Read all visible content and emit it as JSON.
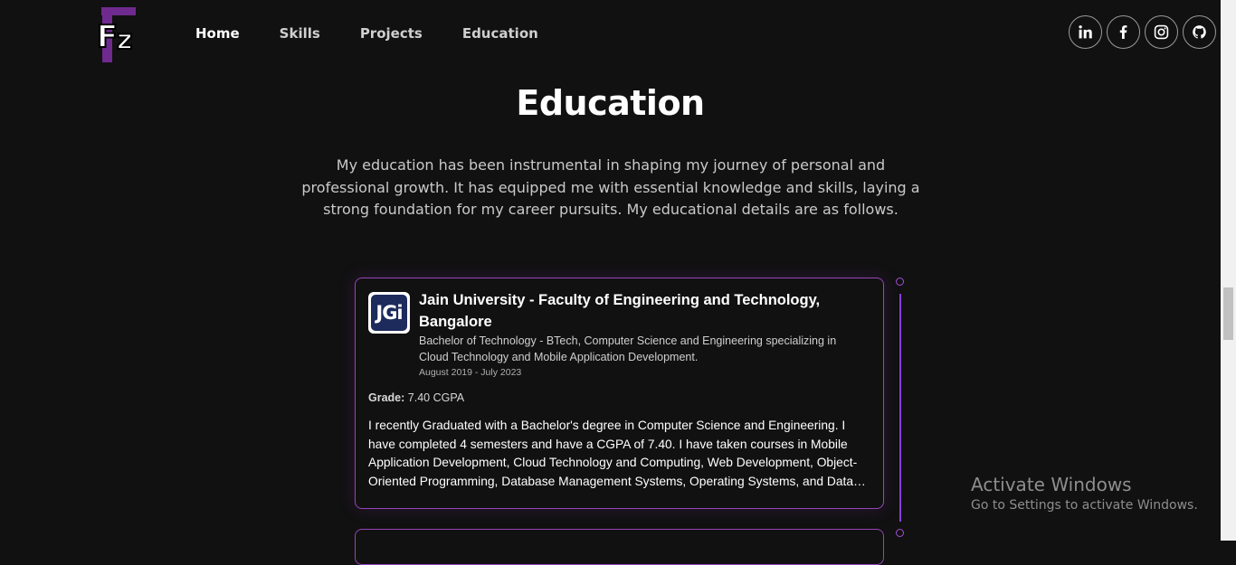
{
  "nav": {
    "logo_text": "FZ",
    "links": [
      "Home",
      "Skills",
      "Projects",
      "Education"
    ],
    "active": "Home",
    "social_icons": [
      "linkedin-icon",
      "facebook-icon",
      "instagram-icon",
      "github-icon"
    ]
  },
  "section": {
    "title": "Education",
    "description": "My education has been instrumental in shaping my journey of personal and professional growth. It has equipped me with essential knowledge and skills, laying a strong foundation for my career pursuits. My educational details are as follows."
  },
  "education": [
    {
      "logo_text": "JGi",
      "institution": "Jain University - Faculty of Engineering and Technology, Bangalore",
      "degree": "Bachelor of Technology - BTech, Computer Science and Engineering specializing in Cloud Technology and Mobile Application Development.",
      "dates": "August 2019 - July 2023",
      "grade_label": "Grade:",
      "grade_value": "7.40 CGPA",
      "description": "I recently Graduated with a Bachelor's degree in Computer Science and Engineering. I have completed 4 semesters and have a CGPA of 7.40. I have taken courses in Mobile Application Development, Cloud Technology and Computing, Web Development, Object-Oriented Programming, Database Management Systems, Operating Systems, and Data…"
    }
  ],
  "watermark": {
    "title": "Activate Windows",
    "subtitle": "Go to Settings to activate Windows."
  },
  "colors": {
    "background": "#111111",
    "accent": "#9645b8",
    "timeline": "#8a3fd8",
    "logo_purple": "#6f2a8f"
  }
}
